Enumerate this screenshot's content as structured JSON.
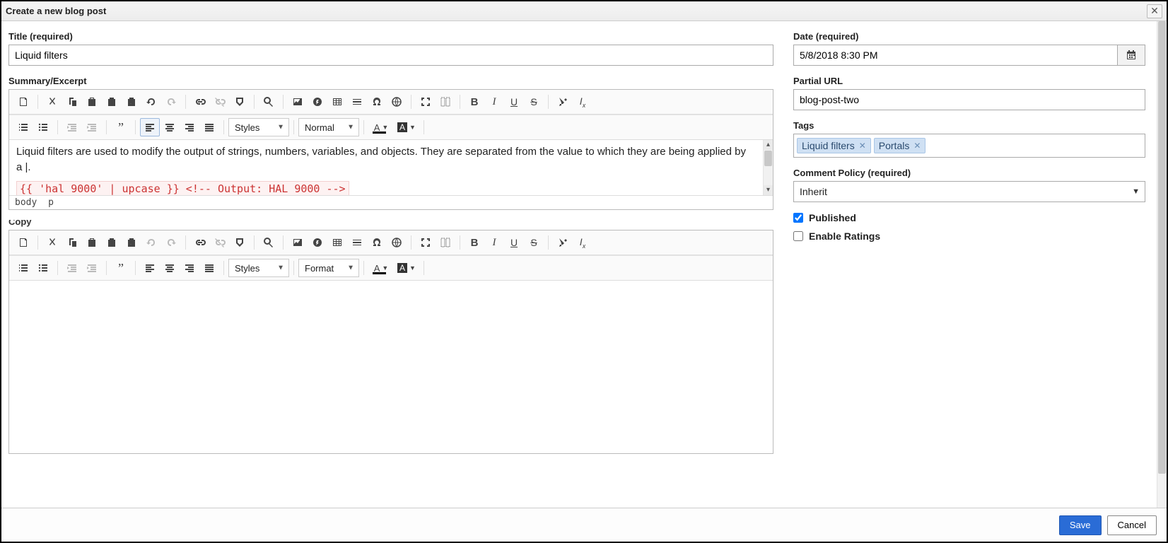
{
  "dialog": {
    "title": "Create a new blog post",
    "save_label": "Save",
    "cancel_label": "Cancel"
  },
  "left": {
    "title_label": "Title (required)",
    "title_value": "Liquid filters",
    "summary_label": "Summary/Excerpt",
    "summary_body_text": "Liquid filters are used to modify the output of strings, numbers, variables, and objects. They are separated from the value to which they are being applied by a |.",
    "summary_code_text": "{{ 'hal 9000' | upcase }} <!-- Output: HAL 9000 -->",
    "summary_path_body": "body",
    "summary_path_p": "p",
    "copy_label_cut": "Copy",
    "toolbar1": {
      "styles": "Styles",
      "format": "Normal"
    },
    "toolbar2": {
      "styles": "Styles",
      "format": "Format"
    }
  },
  "right": {
    "date_label": "Date (required)",
    "date_value": "5/8/2018 8:30 PM",
    "url_label": "Partial URL",
    "url_value": "blog-post-two",
    "tags_label": "Tags",
    "tags": [
      {
        "label": "Liquid filters"
      },
      {
        "label": "Portals"
      }
    ],
    "policy_label": "Comment Policy (required)",
    "policy_value": "Inherit",
    "published_label": "Published",
    "published_checked": true,
    "ratings_label": "Enable Ratings",
    "ratings_checked": false
  }
}
